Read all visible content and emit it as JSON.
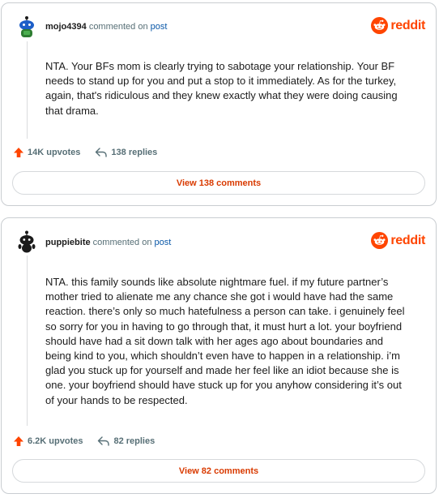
{
  "brand": {
    "wordmark": "reddit",
    "color": "#ff4500"
  },
  "comments": [
    {
      "username": "mojo4394",
      "commented_on": "commented on",
      "post_link": "post",
      "body": "NTA. Your BFs mom is clearly trying to sabotage your relationship. Your BF needs to stand up for you and put a stop to it immediately. As for the turkey, again, that's ridiculous and they knew exactly what they were doing causing that drama.",
      "upvotes": "14K upvotes",
      "replies": "138 replies",
      "view_button": "View 138 comments",
      "avatar": "snoo-avatar-blue-icon"
    },
    {
      "username": "puppiebite",
      "commented_on": "commented on",
      "post_link": "post",
      "body": "NTA. this family sounds like absolute nightmare fuel. if my future partner’s mother tried to alienate me any chance she got i would have had the same reaction. there’s only so much hatefulness a person can take. i genuinely feel so sorry for you in having to go through that, it must hurt a lot. your boyfriend should have had a sit down talk with her ages ago about boundaries and being kind to you, which shouldn’t even have to happen in a relationship. i’m glad you stuck up for yourself and made her feel like an idiot because she is one. your boyfriend should have stuck up for you anyhow considering it’s out of your hands to be respected.",
      "upvotes": "6.2K upvotes",
      "replies": "82 replies",
      "view_button": "View 82 comments",
      "avatar": "snoo-avatar-black-icon"
    }
  ],
  "colors": {
    "upvote_arrow": "#ff4500",
    "view_button_text": "#d93a00",
    "link": "#0a58a8",
    "meta_text": "#576f76"
  }
}
